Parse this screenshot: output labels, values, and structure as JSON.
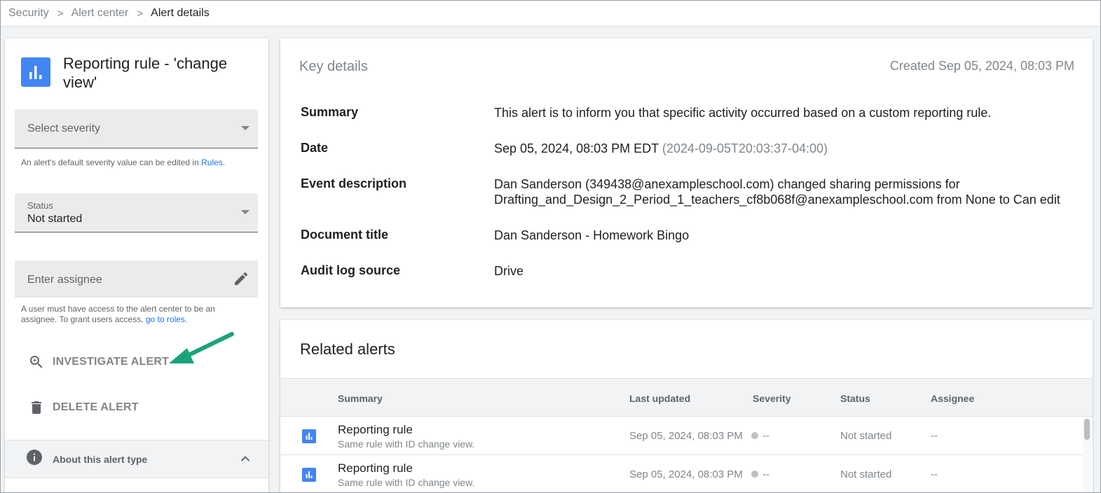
{
  "breadcrumb": {
    "items": [
      "Security",
      "Alert center"
    ],
    "current": "Alert details",
    "separator": ">"
  },
  "left_panel": {
    "title": "Reporting rule - 'change view'",
    "severity": {
      "placeholder": "Select severity",
      "helper_prefix": "An alert's default severity value can be edited in ",
      "helper_link": "Rules",
      "helper_suffix": "."
    },
    "status": {
      "label": "Status",
      "value": "Not started"
    },
    "assignee": {
      "placeholder": "Enter assignee",
      "helper_prefix": "A user must have access to the alert center to be an assignee. To grant users access, ",
      "helper_link": "go to roles",
      "helper_suffix": "."
    },
    "actions": {
      "investigate": "INVESTIGATE ALERT",
      "delete": "DELETE ALERT"
    },
    "about": "About this alert type"
  },
  "key_details": {
    "title": "Key details",
    "created": "Created Sep 05, 2024, 08:03 PM",
    "rows": [
      {
        "label": "Summary",
        "value": "This alert is to inform you that specific activity occurred based on a custom reporting rule."
      },
      {
        "label": "Date",
        "value": "Sep 05, 2024, 08:03 PM EDT",
        "extra": "(2024-09-05T20:03:37-04:00)"
      },
      {
        "label": "Event description",
        "value": "Dan Sanderson (349438@anexampleschool.com) changed sharing permissions for",
        "value2": "Drafting_and_Design_2_Period_1_teachers_cf8b068f@anexampleschool.com from None to Can edit"
      },
      {
        "label": "Document title",
        "value": "Dan Sanderson - Homework Bingo"
      },
      {
        "label": "Audit log source",
        "value": "Drive"
      }
    ]
  },
  "related_alerts": {
    "title": "Related alerts",
    "columns": [
      "Summary",
      "Last updated",
      "Severity",
      "Status",
      "Assignee"
    ],
    "rows": [
      {
        "summary": "Reporting rule",
        "sub": "Same rule with ID change view.",
        "updated": "Sep 05, 2024, 08:03 PM",
        "severity": "--",
        "status": "Not started",
        "assignee": "--"
      },
      {
        "summary": "Reporting rule",
        "sub": "Same rule with ID change view.",
        "updated": "Sep 05, 2024, 08:03 PM",
        "severity": "--",
        "status": "Not started",
        "assignee": "--"
      }
    ]
  },
  "colors": {
    "accent": "#4285f4",
    "link": "#1a73e8",
    "annotation_arrow": "#1aa37a"
  }
}
